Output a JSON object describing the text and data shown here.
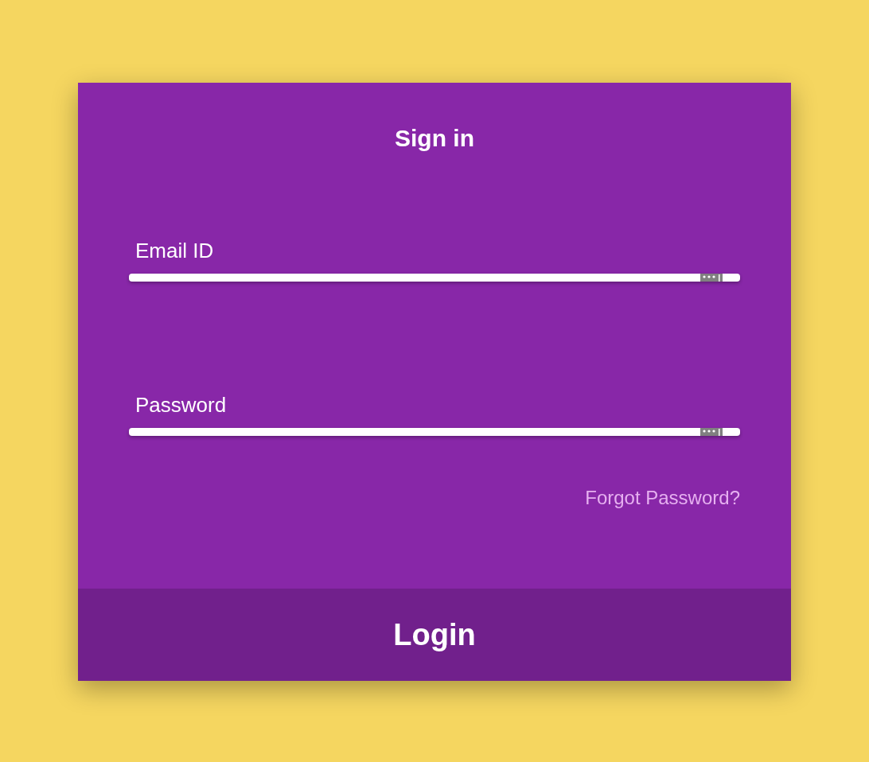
{
  "title": "Sign in",
  "fields": [
    {
      "label": "Email ID"
    },
    {
      "label": "Password"
    }
  ],
  "forgot_link": "Forgot Password?",
  "login_button": "Login"
}
